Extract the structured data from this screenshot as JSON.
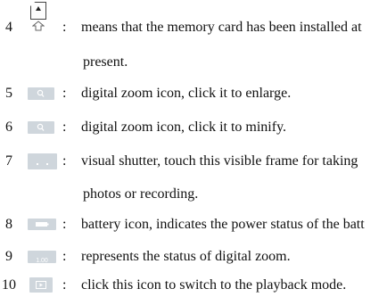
{
  "items": [
    {
      "number": "4",
      "icon": "sd-card-icon",
      "lines": [
        "means that the memory card has been installed at",
        "present."
      ]
    },
    {
      "number": "5",
      "icon": "zoom-in-icon",
      "lines": [
        "digital zoom icon, click it to enlarge."
      ]
    },
    {
      "number": "6",
      "icon": "zoom-out-icon",
      "lines": [
        "digital zoom icon, click it to minify."
      ]
    },
    {
      "number": "7",
      "icon": "shutter-frame-icon",
      "lines": [
        "visual shutter, touch this visible frame for taking",
        "photos or recording."
      ]
    },
    {
      "number": "8",
      "icon": "battery-icon",
      "lines": [
        "battery icon, indicates the power status of the batt"
      ]
    },
    {
      "number": "9",
      "icon": "zoom-level-icon",
      "icon_text": "1.00",
      "lines": [
        "represents the status of digital zoom."
      ]
    },
    {
      "number": "10",
      "icon": "playback-icon",
      "lines": [
        "click this icon to switch to the playback mode."
      ]
    }
  ],
  "separator": ":",
  "colors": {
    "icon_background": "#cfd6dc",
    "text": "#111111"
  }
}
